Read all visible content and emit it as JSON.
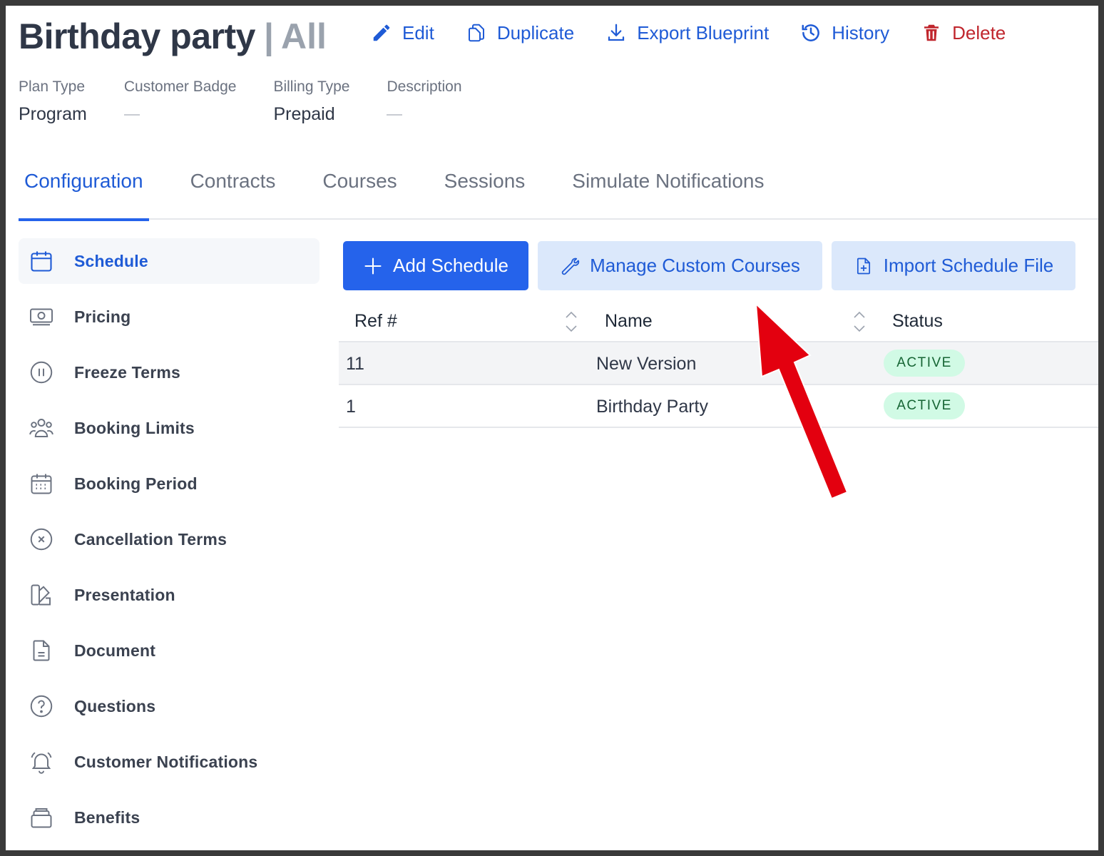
{
  "header": {
    "title": "Birthday party",
    "separator": "|",
    "scope": "All",
    "actions": {
      "edit": "Edit",
      "duplicate": "Duplicate",
      "export": "Export Blueprint",
      "history": "History",
      "delete": "Delete"
    }
  },
  "meta": {
    "plan_type_label": "Plan Type",
    "plan_type_value": "Program",
    "customer_badge_label": "Customer Badge",
    "billing_type_label": "Billing Type",
    "billing_type_value": "Prepaid",
    "description_label": "Description"
  },
  "tabs": [
    "Configuration",
    "Contracts",
    "Courses",
    "Sessions",
    "Simulate Notifications"
  ],
  "sidebar": {
    "items": [
      {
        "label": "Schedule",
        "icon": "calendar-icon"
      },
      {
        "label": "Pricing",
        "icon": "money-icon"
      },
      {
        "label": "Freeze Terms",
        "icon": "pause-icon"
      },
      {
        "label": "Booking Limits",
        "icon": "users-icon"
      },
      {
        "label": "Booking Period",
        "icon": "calendar-grid-icon"
      },
      {
        "label": "Cancellation Terms",
        "icon": "x-circle-icon"
      },
      {
        "label": "Presentation",
        "icon": "swatch-icon"
      },
      {
        "label": "Document",
        "icon": "document-icon"
      },
      {
        "label": "Questions",
        "icon": "question-icon"
      },
      {
        "label": "Customer Notifications",
        "icon": "bell-icon"
      },
      {
        "label": "Benefits",
        "icon": "stack-icon"
      }
    ]
  },
  "toolbar": {
    "add_schedule": "Add Schedule",
    "manage_custom_courses": "Manage Custom Courses",
    "import_schedule_file": "Import Schedule File"
  },
  "table": {
    "columns": [
      "Ref #",
      "Name",
      "Status"
    ],
    "rows": [
      {
        "ref": "11",
        "name": "New Version",
        "status": "ACTIVE"
      },
      {
        "ref": "1",
        "name": "Birthday Party",
        "status": "ACTIVE"
      }
    ]
  },
  "colors": {
    "primary": "#2563eb",
    "link": "#1f5bd6",
    "danger": "#c0262d",
    "active_badge_bg": "#d1fae5",
    "active_badge_text": "#166534",
    "annotation_arrow": "#e3000f"
  }
}
